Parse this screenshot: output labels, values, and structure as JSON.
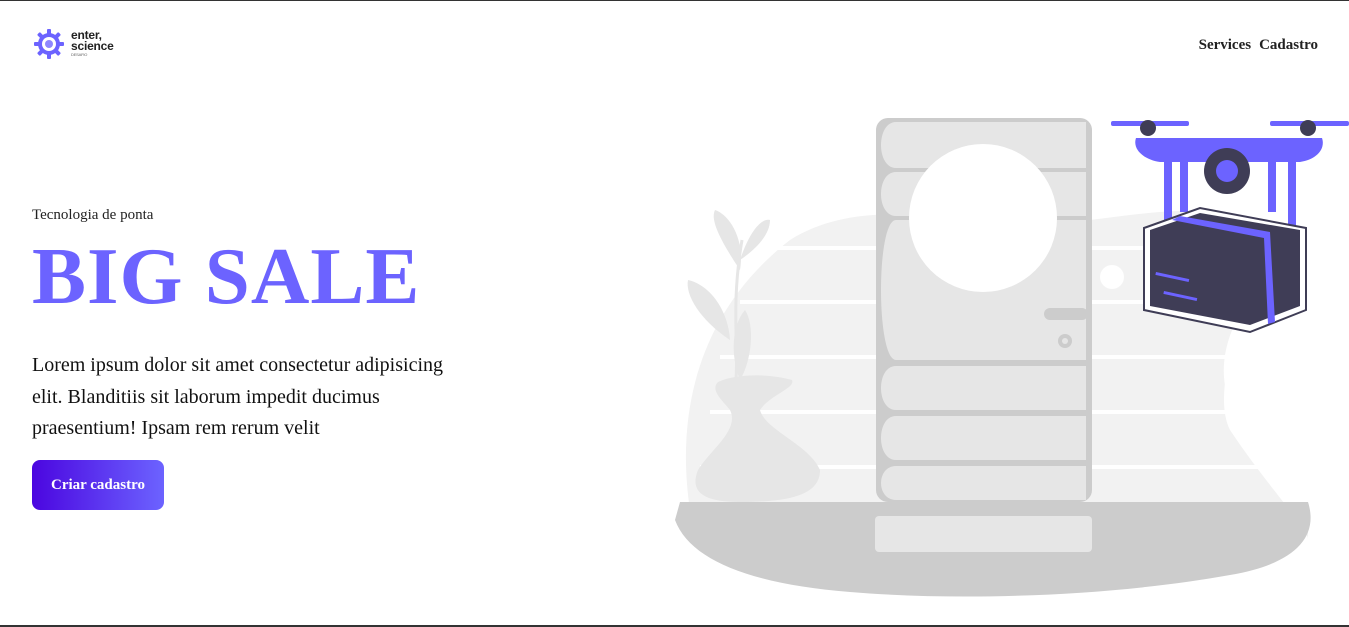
{
  "brand": {
    "name_line1": "enter,",
    "name_line2": "science",
    "tagline": "DESAFIO"
  },
  "nav": {
    "items": [
      "Services",
      "Cadastro"
    ]
  },
  "hero": {
    "eyebrow": "Tecnologia de ponta",
    "title": "BIG SALE",
    "description": "Lorem ipsum dolor sit amet consectetur adipisicing elit. Blanditiis sit laborum impedit ducimus praesentium! Ipsam rem rerum velit",
    "cta_label": "Criar cadastro"
  },
  "colors": {
    "accent": "#6c63ff",
    "cta_gradient_start": "#4b06e0",
    "drone_dark": "#3f3d56",
    "illustration_gray": "#cccccc"
  },
  "icons": [
    "gear-logo-icon",
    "drone-icon",
    "refrigerator-icon",
    "plant-vase-icon"
  ]
}
